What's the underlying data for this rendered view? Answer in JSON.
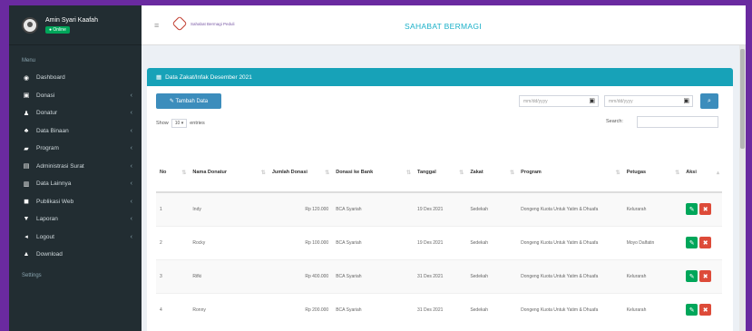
{
  "user": {
    "name": "Amin Syari Kaafah",
    "status": "● Online"
  },
  "sidebar": {
    "header": "Menu",
    "items": [
      {
        "icon": "dashboard-icon",
        "glyph": "◉",
        "label": "Dashboard",
        "chevron": ""
      },
      {
        "icon": "donasi-icon",
        "glyph": "▣",
        "label": "Donasi",
        "chevron": "‹"
      },
      {
        "icon": "donatur-icon",
        "glyph": "♟",
        "label": "Donatur",
        "chevron": "‹"
      },
      {
        "icon": "data-binaan-icon",
        "glyph": "♣",
        "label": "Data Binaan",
        "chevron": "‹"
      },
      {
        "icon": "program-icon",
        "glyph": "▰",
        "label": "Program",
        "chevron": "‹"
      },
      {
        "icon": "administrasi-icon",
        "glyph": "▤",
        "label": "Administrasi Surat",
        "chevron": "‹"
      },
      {
        "icon": "data-lainnya-icon",
        "glyph": "▥",
        "label": "Data Lainnya",
        "chevron": "‹"
      },
      {
        "icon": "publikasi-icon",
        "glyph": "◼",
        "label": "Publikasi Web",
        "chevron": "‹"
      },
      {
        "icon": "laporan-icon",
        "glyph": "▼",
        "label": "Laporan",
        "chevron": "‹"
      },
      {
        "icon": "logout-icon",
        "glyph": "◂",
        "label": "Logout",
        "chevron": "‹"
      },
      {
        "icon": "download-icon",
        "glyph": "▲",
        "label": "Download",
        "chevron": ""
      }
    ],
    "footer_header": "Settings"
  },
  "topbar": {
    "menu_glyph": "≡",
    "logo_text": "Sahabat Bermagi Peduli",
    "title": "SAHABAT BERMAGI"
  },
  "card": {
    "title": "Data Zakat/Infak Desember 2021",
    "add_button": "✎ Tambah Data",
    "date_placeholder": "mm/dd/yyyy",
    "show_label": "Show",
    "show_value": "10",
    "entries_label": "entries",
    "search_label": "Search:"
  },
  "table": {
    "headers": [
      "No",
      "Nama Donatur",
      "Jumlah Donasi",
      "Donasi ke Bank",
      "Tanggal",
      "Zakat",
      "Program",
      "Petugas",
      "Aksi"
    ],
    "rows": [
      [
        "1",
        "Indy",
        "Rp 120.000",
        "BCA Syariah",
        "19 Des 2021",
        "Sedekah",
        "Dongeng Kuota Untuk Yatim & Dhuafa",
        "Kelurarah"
      ],
      [
        "2",
        "Rocky",
        "Rp 100.000",
        "BCA Syariah",
        "19 Des 2021",
        "Sedekah",
        "Dongeng Kuota Untuk Yatim & Dhuafa",
        "Moyo Dalfatin"
      ],
      [
        "3",
        "Rifki",
        "Rp 400.000",
        "BCA Syariah",
        "31 Des 2021",
        "Sedekah",
        "Dongeng Kuota Untuk Yatim & Dhuafa",
        "Kelurarah"
      ],
      [
        "4",
        "Ronny",
        "Rp 200.000",
        "BCA Syariah",
        "31 Des 2021",
        "Sedekah",
        "Dongeng Kuota Untuk Yatim & Dhuafa",
        "Kelurarah"
      ]
    ]
  },
  "colors": {
    "sidebar": "#222d32",
    "accent": "#17a2b8",
    "primary": "#3c8dbc",
    "edit": "#00a65a",
    "delete": "#dd4b39"
  }
}
